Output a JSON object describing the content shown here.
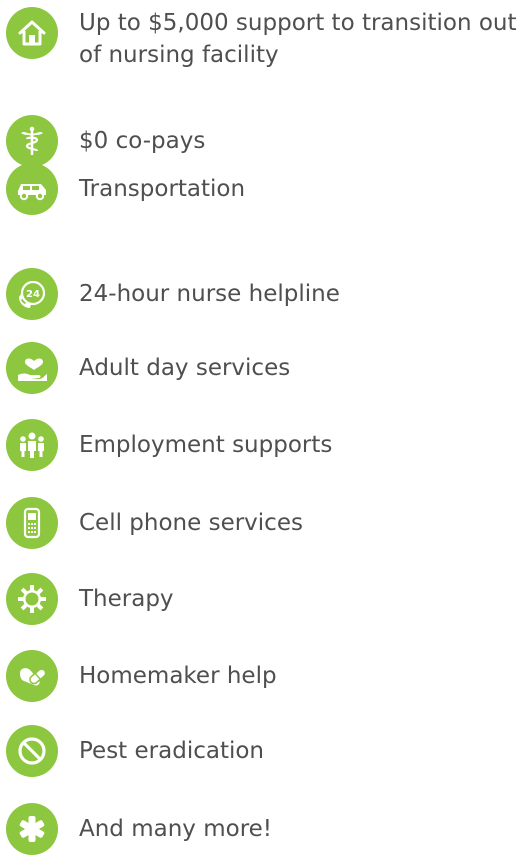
{
  "benefits": [
    {
      "icon": "house-icon",
      "label": "Up to $5,000 support to transition out of nursing facility"
    },
    {
      "icon": "caduceus-icon",
      "label": "$0 co-pays"
    },
    {
      "icon": "car-icon",
      "label": "Transportation"
    },
    {
      "icon": "phone-24-hour-icon",
      "label": "24-hour nurse helpline"
    },
    {
      "icon": "hand-heart-icon",
      "label": "Adult day services"
    },
    {
      "icon": "people-group-icon",
      "label": "Employment supports"
    },
    {
      "icon": "cell-phone-icon",
      "label": "Cell phone services"
    },
    {
      "icon": "gear-icon",
      "label": "Therapy"
    },
    {
      "icon": "hand-pill-icon",
      "label": "Homemaker help"
    },
    {
      "icon": "no-symbol-icon",
      "label": "Pest eradication"
    },
    {
      "icon": "asterisk-icon",
      "label": "And many more!"
    }
  ],
  "colors": {
    "icon_background": "#8dc63f",
    "text": "#4f4f51"
  }
}
